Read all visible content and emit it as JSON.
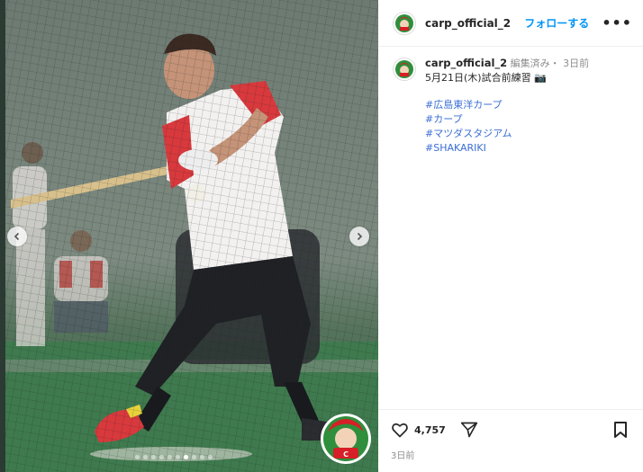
{
  "post": {
    "username": "carp_official_2",
    "follow_label": "フォローする",
    "more_label": "•••",
    "caption_user": "carp_official_2",
    "caption_meta": " 編集済み・ 3日前",
    "caption_text": "5月21日(木)試合前練習 📷",
    "hashtags": [
      "#広島東洋カープ",
      "#カープ",
      "#マツダスタジアム",
      "#SHAKARIKI"
    ],
    "likes": "4,757",
    "time_ago": "3日前"
  },
  "carousel": {
    "slides": 10,
    "active_index": 6
  },
  "colors": {
    "link": "#3b6fd4",
    "follow": "#0095f6",
    "carp_red": "#d61f26"
  }
}
